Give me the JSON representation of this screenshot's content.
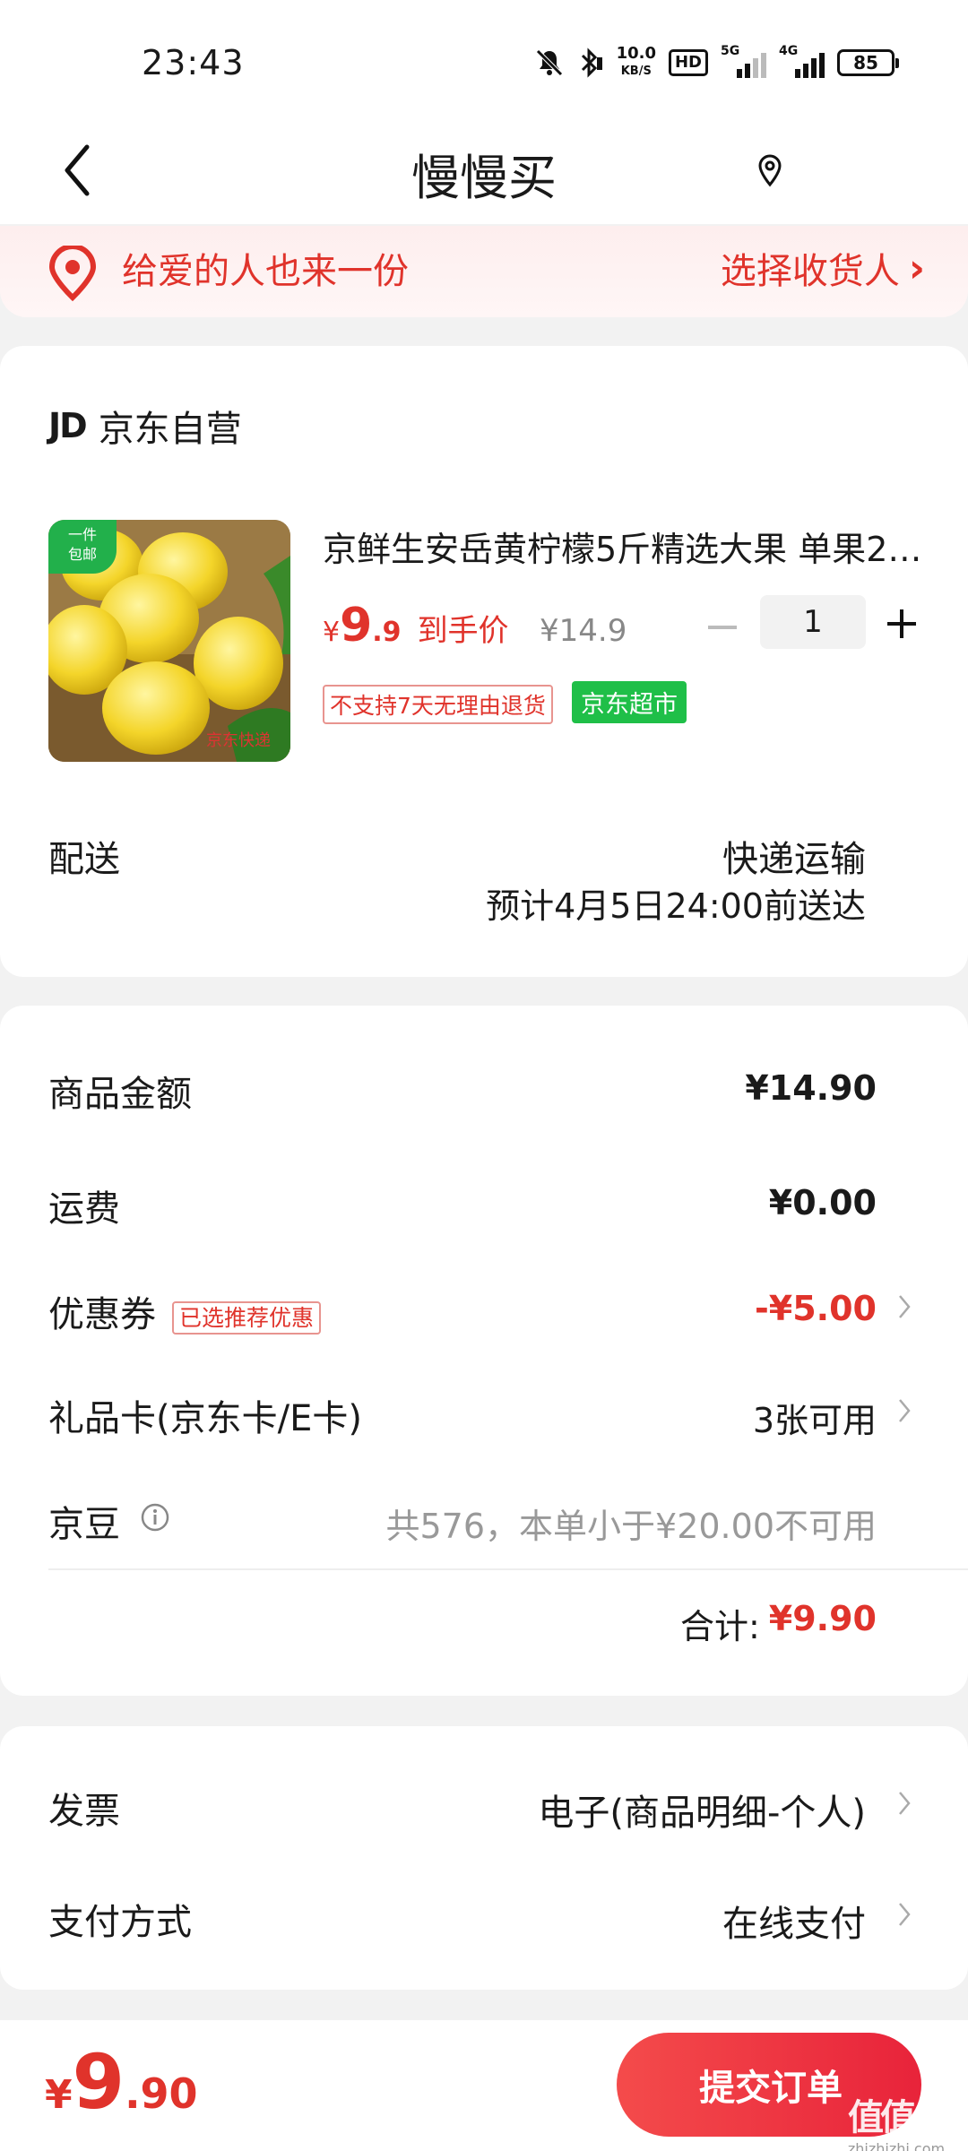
{
  "status_bar": {
    "time": "23:43",
    "speed_value": "10.0",
    "speed_unit": "KB/S",
    "hd_label": "HD",
    "sim1_label": "5G",
    "sim2_label": "4G",
    "battery": "85"
  },
  "nav": {
    "title": "慢慢买"
  },
  "banner": {
    "left_text": "给爱的人也来一份",
    "right_text": "选择收货人",
    "right_chevron": "›"
  },
  "shop": {
    "logo": "JD",
    "name": "京东自营"
  },
  "product": {
    "image_tag_line1": "一件",
    "image_tag_line2": "包邮",
    "image_caption": "京东快递",
    "title": "京鲜生安岳黄柠檬5斤精选大果 单果2…",
    "price_symbol": "¥",
    "price_int": "9",
    "price_dec": ".9",
    "price_label": "到手价",
    "original_price": "¥14.9",
    "quantity": "1",
    "tag_return": "不支持7天无理由退货",
    "tag_store": "京东超市"
  },
  "shipping": {
    "label": "配送",
    "mode": "快递运输",
    "eta": "预计4月5日24:00前送达"
  },
  "summary": {
    "goods_label": "商品金额",
    "goods_value": "¥14.90",
    "freight_label": "运费",
    "freight_value": "¥0.00",
    "coupon_label": "优惠券",
    "coupon_tag": "已选推荐优惠",
    "coupon_value": "-¥5.00",
    "giftcard_label": "礼品卡(京东卡/E卡)",
    "giftcard_value": "3张可用",
    "beans_label": "京豆",
    "beans_value": "共576，本单小于¥20.00不可用",
    "total_label": "合计:",
    "total_value": "¥9.90"
  },
  "extras": {
    "invoice_label": "发票",
    "invoice_value": "电子(商品明细-个人)",
    "payment_label": "支付方式",
    "payment_value": "在线支付"
  },
  "bottom": {
    "total_symbol": "¥",
    "total_int": "9",
    "total_dec": ".90",
    "submit_label": "提交订单",
    "watermark_big": "值值值",
    "watermark_small": "zhizhizhi.com"
  },
  "colors": {
    "accent_red": "#e0332b",
    "tag_green": "#1fbf48"
  }
}
